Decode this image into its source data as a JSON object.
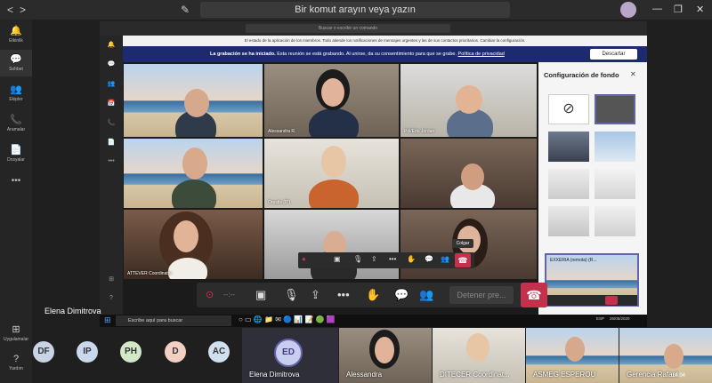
{
  "title_bar": {
    "search_placeholder": "Bir komut arayın veya yazın",
    "nav_back": "<",
    "nav_forward": ">",
    "compose_icon": "✎",
    "win_minimize": "—",
    "win_maximize": "❐",
    "win_close": "✕"
  },
  "left_rail": [
    {
      "label": "Etkinlik",
      "icon": "bell-icon",
      "glyph": "🔔"
    },
    {
      "label": "Sohbet",
      "icon": "chat-icon",
      "glyph": "💬",
      "active": true
    },
    {
      "label": "Ekipler",
      "icon": "teams-icon",
      "glyph": "👥"
    },
    {
      "label": "Aramalar",
      "icon": "phone-icon",
      "glyph": "📞"
    },
    {
      "label": "Dosyalar",
      "icon": "file-icon",
      "glyph": "📄"
    },
    {
      "label": "•••",
      "icon": "more-icon",
      "glyph": ""
    }
  ],
  "left_rail_bottom": [
    {
      "label": "Uygulamalar",
      "icon": "apps-icon",
      "glyph": "⊞"
    },
    {
      "label": "Yardım",
      "icon": "help-icon",
      "glyph": "?"
    }
  ],
  "remote": {
    "search": "Buscar o escribir un comando",
    "org_banner": "El estado de la aplicación de los miembros. Todo atiende los notificaciones de mensajes urgentes y las de sus contactos prioritarios. Cambiar la configuración.",
    "recording_bold": "La grabación se ha iniciado.",
    "recording_text": "Esta reunión se está grabando. Al unirse, da su consentimiento para que se grabe.",
    "privacy_link": "Política de privacidad",
    "discard_button": "Descartar",
    "hangup_tooltip": "Colgar",
    "taskbar_search": "Escribe aquí para buscar",
    "tray_lang": "ESP",
    "tray_date": "26/05/2020"
  },
  "video_tiles": [
    {
      "name": "",
      "bg": "beach"
    },
    {
      "name": "Alessandra R.",
      "bg": "room"
    },
    {
      "name": "Pol/Edu Jordan",
      "bg": "room2"
    },
    {
      "name": "",
      "bg": "beach"
    },
    {
      "name": "Orestis (IT)",
      "bg": "room4"
    },
    {
      "name": "",
      "bg": "room3"
    },
    {
      "name": "ATTEVER Coordinator",
      "bg": "room5"
    },
    {
      "name": "",
      "bg": "room6"
    },
    {
      "name": "",
      "bg": "room3"
    }
  ],
  "background_panel": {
    "title": "Configuración de fondo",
    "preview_label": "EXXERIA (remota) (R..."
  },
  "call_controls": {
    "timer": "--:--",
    "stop_presenting": "Detener pre..."
  },
  "bottom": {
    "presenter_name": "Elena Dimitrova",
    "avatars": [
      {
        "initials": "DF",
        "color": "#c8d3e6"
      },
      {
        "initials": "IP",
        "color": "#c9d8ee"
      },
      {
        "initials": "PH",
        "color": "#d3e8c6"
      },
      {
        "initials": "D",
        "color": "#f2d0c4"
      },
      {
        "initials": "AC",
        "color": "#d1e0ee"
      }
    ],
    "self_tile": {
      "initials": "ED",
      "name": "Elena Dimitrova"
    },
    "video_tiles": [
      {
        "name": "Alessandra",
        "muted": true
      },
      {
        "name": "DITECER Coordinat...",
        "muted": true
      },
      {
        "name": "ASMEG ESPEROU",
        "muted": true
      },
      {
        "name": "Gerencia Rafael",
        "muted": false
      }
    ],
    "clock": "14:04"
  }
}
